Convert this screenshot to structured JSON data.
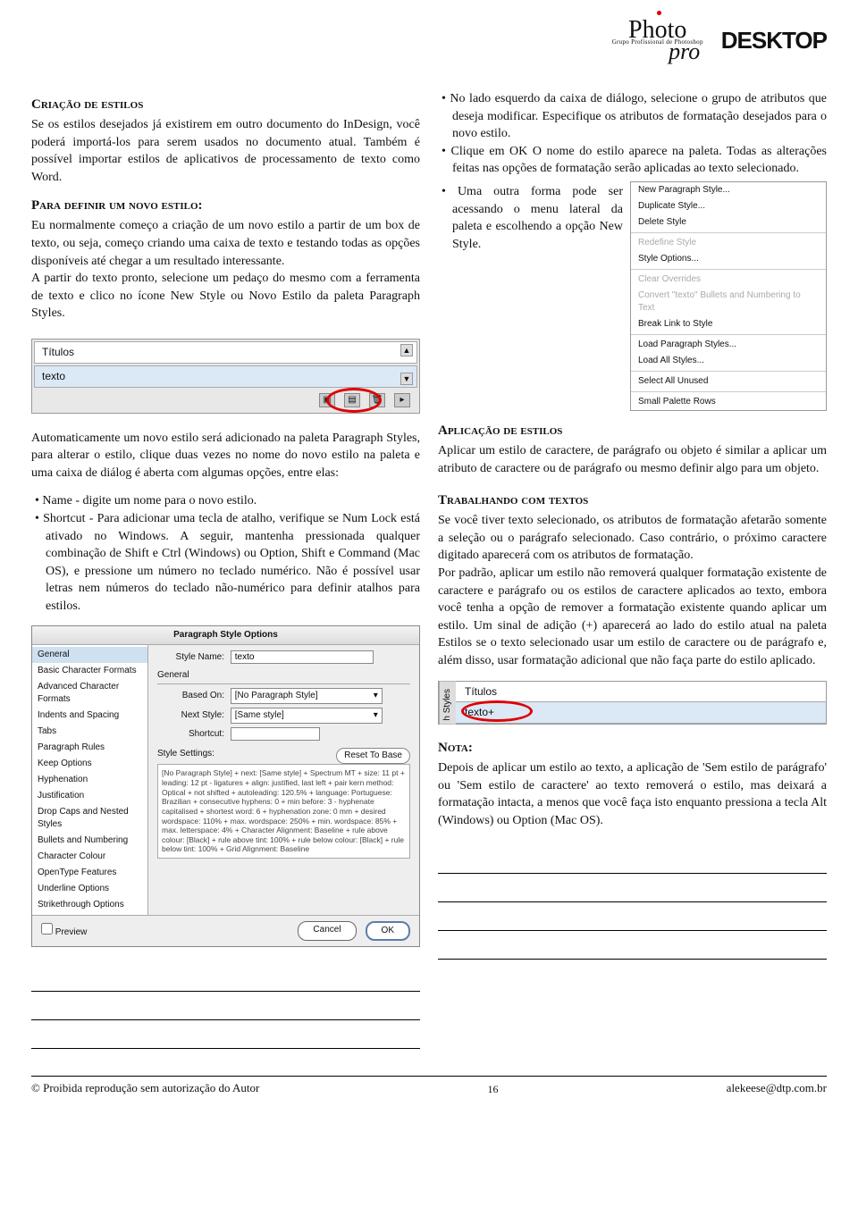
{
  "header": {
    "logo1_main": "Photo",
    "logo1_sub": "Grupo Profissional de Photoshop",
    "logo1_pro": "pro",
    "logo2_a": "DESK",
    "logo2_b": "TOP"
  },
  "left": {
    "h1": "Criação de estilos",
    "p1": "Se os estilos desejados já existirem em outro documento do InDesign, você poderá importá-los para serem usados no documento atual. Também é possível importar estilos de aplicativos de processamento de texto como Word.",
    "h2": "Para definir um novo estilo:",
    "p2": "Eu normalmente começo a criação de um novo estilo a partir de um box de texto, ou seja, começo criando uma caixa de texto e testando todas as opções disponíveis até chegar a um resultado interessante.",
    "p3": "A partir do texto pronto, selecione um pedaço do mesmo com a ferramenta de texto e clico no ícone New Style ou Novo Estilo da paleta Paragraph Styles.",
    "palette": {
      "row1": "Títulos",
      "row2": "texto"
    },
    "p4": "Automaticamente um novo estilo será adicionado na paleta Paragraph Styles, para alterar o estilo, clique duas vezes no nome do novo estilo na paleta e uma caixa de diálog é aberta com algumas opções, entre elas:",
    "bullets": [
      "Name - digite um nome para o novo estilo.",
      "Shortcut - Para adicionar uma tecla de atalho, verifique se Num Lock está ativado no Windows. A seguir, mantenha pressionada qualquer combinação de Shift e Ctrl (Windows) ou Option, Shift e Command (Mac OS), e pressione um número no teclado numérico. Não é possível usar letras nem números do teclado não-numérico para definir atalhos para estilos."
    ],
    "dialog": {
      "title": "Paragraph Style Options",
      "sidebar": [
        "General",
        "Basic Character Formats",
        "Advanced Character Formats",
        "Indents and Spacing",
        "Tabs",
        "Paragraph Rules",
        "Keep Options",
        "Hyphenation",
        "Justification",
        "Drop Caps and Nested Styles",
        "Bullets and Numbering",
        "Character Colour",
        "OpenType Features",
        "Underline Options",
        "Strikethrough Options"
      ],
      "styleNameLabel": "Style Name:",
      "styleName": "texto",
      "generalLabel": "General",
      "basedOnLabel": "Based On:",
      "basedOn": "[No Paragraph Style]",
      "nextStyleLabel": "Next Style:",
      "nextStyle": "[Same style]",
      "shortcutLabel": "Shortcut:",
      "settingsLabel": "Style Settings:",
      "resetBtn": "Reset To Base",
      "settingsText": "[No Paragraph Style] + next: [Same style] + Spectrum MT + size: 11 pt + leading: 12 pt - ligatures + align: justified, last left + pair kern method: Optical + not shifted + autoleading: 120.5% + language: Portuguese: Brazilian + consecutive hyphens: 0 + min before: 3 - hyphenate capitalised + shortest word: 6 + hyphenation zone: 0 mm + desired wordspace: 110% + max. wordspace: 250% + min. wordspace: 85% + max. letterspace: 4% + Character Alignment: Baseline + rule above colour: [Black] + rule above tint: 100% + rule below colour: [Black] + rule below tint: 100% + Grid Alignment: Baseline",
      "preview": "Preview",
      "cancel": "Cancel",
      "ok": "OK"
    }
  },
  "right": {
    "bullets1": [
      "No lado esquerdo da caixa de diálogo, selecione o grupo de atributos que deseja modificar. Especifique os atributos de formatação desejados para o novo estilo.",
      "Clique em OK O nome do estilo aparece na paleta. Todas as alterações feitas nas opções de formatação serão aplicadas ao texto selecionado."
    ],
    "menu": {
      "items": [
        {
          "t": "New Paragraph Style...",
          "d": false
        },
        {
          "t": "Duplicate Style...",
          "d": false
        },
        {
          "t": "Delete Style",
          "d": false
        },
        {
          "t": "Redefine Style",
          "d": true
        },
        {
          "t": "Style Options...",
          "d": false
        },
        {
          "t": "Clear Overrides",
          "d": true
        },
        {
          "t": "Convert \"texto\" Bullets and Numbering to Text",
          "d": true
        },
        {
          "t": "Break Link to Style",
          "d": false
        },
        {
          "t": "Load Paragraph Styles...",
          "d": false
        },
        {
          "t": "Load All Styles...",
          "d": false
        },
        {
          "t": "Select All Unused",
          "d": false
        },
        {
          "t": "Small Palette Rows",
          "d": false
        }
      ]
    },
    "wrap1": "Uma outra forma pode ser acessando o menu lateral da paleta e escolhendo a opção New Style.",
    "h3": "Aplicação de estilos",
    "p5": "Aplicar um estilo de caractere, de parágrafo ou objeto é similar a aplicar um atributo de caractere ou de parágrafo ou mesmo definir algo para um objeto.",
    "h4": "Trabalhando com textos",
    "p6": "Se você tiver texto selecionado, os atributos de formatação afetarão somente a seleção ou o parágrafo selecionado. Caso contrário, o próximo caractere digitado aparecerá com os atributos de formatação.",
    "p7": "Por padrão, aplicar um estilo não removerá qualquer formatação existente de caractere e parágrafo ou os estilos de caractere aplicados ao texto, embora você tenha a opção de remover a formatação existente quando aplicar um estilo. Um sinal de adição (+) aparecerá ao lado do estilo atual na paleta Estilos se o texto selecionado usar um estilo de caractere ou de parágrafo e, além disso, usar formatação adicional que não faça parte do estilo aplicado.",
    "palette2": {
      "tab": "h Styles",
      "row1": "Títulos",
      "row2": "texto+"
    },
    "h5": "Nota:",
    "p8": "Depois de aplicar um estilo ao texto, a aplicação de 'Sem estilo de parágrafo' ou 'Sem estilo de caractere' ao texto removerá o estilo, mas deixará a formatação intacta, a menos que você faça isto enquanto pressiona a tecla Alt (Windows) ou Option (Mac OS)."
  },
  "footer": {
    "left": "© Proibida reprodução sem autorização do Autor",
    "page": "16",
    "right": "alekeese@dtp.com.br"
  }
}
